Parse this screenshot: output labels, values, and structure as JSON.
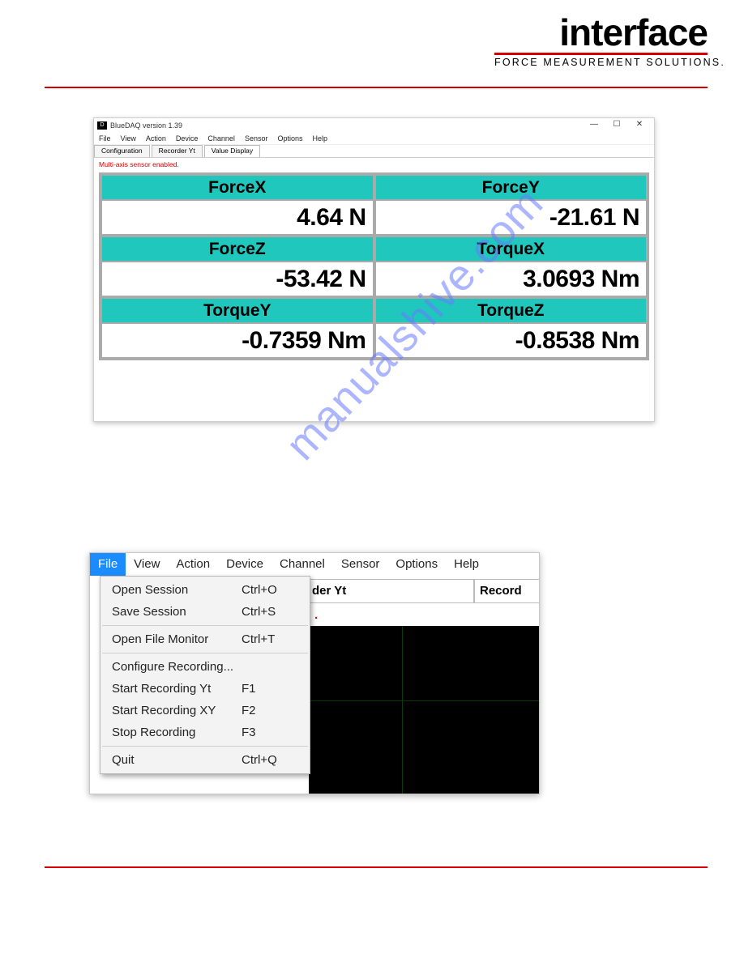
{
  "logo": {
    "word": "interface",
    "tagline": "FORCE MEASUREMENT SOLUTIONS."
  },
  "watermark": "manualshive.com",
  "ss1": {
    "title": "BlueDAQ version 1.39",
    "menus": [
      "File",
      "View",
      "Action",
      "Device",
      "Channel",
      "Sensor",
      "Options",
      "Help"
    ],
    "tabs": [
      "Configuration",
      "Recorder Yt",
      "Value Display"
    ],
    "active_tab_index": 2,
    "status": "Multi-axis sensor enabled.",
    "win": {
      "min": "—",
      "max": "☐",
      "close": "✕"
    },
    "cells": [
      {
        "label": "ForceX",
        "value": "4.64 N"
      },
      {
        "label": "ForceY",
        "value": "-21.61 N"
      },
      {
        "label": "ForceZ",
        "value": "-53.42 N"
      },
      {
        "label": "TorqueX",
        "value": "3.0693 Nm"
      },
      {
        "label": "TorqueY",
        "value": "-0.7359 Nm"
      },
      {
        "label": "TorqueZ",
        "value": "-0.8538 Nm"
      }
    ]
  },
  "ss2": {
    "menus": [
      "File",
      "View",
      "Action",
      "Device",
      "Channel",
      "Sensor",
      "Options",
      "Help"
    ],
    "active_menu_index": 0,
    "partial_tab": "der Yt",
    "partial_cell": "Record",
    "red_fragment": ".",
    "dropdown": [
      {
        "label": "Open Session",
        "accel": "Ctrl+O"
      },
      {
        "label": "Save Session",
        "accel": "Ctrl+S"
      },
      {
        "sep": true
      },
      {
        "label": "Open File Monitor",
        "accel": "Ctrl+T"
      },
      {
        "sep": true
      },
      {
        "label": "Configure Recording...",
        "accel": ""
      },
      {
        "label": "Start Recording Yt",
        "accel": "F1"
      },
      {
        "label": "Start Recording XY",
        "accel": "F2"
      },
      {
        "label": "Stop Recording",
        "accel": "F3"
      },
      {
        "sep": true
      },
      {
        "label": "Quit",
        "accel": "Ctrl+Q"
      }
    ]
  }
}
